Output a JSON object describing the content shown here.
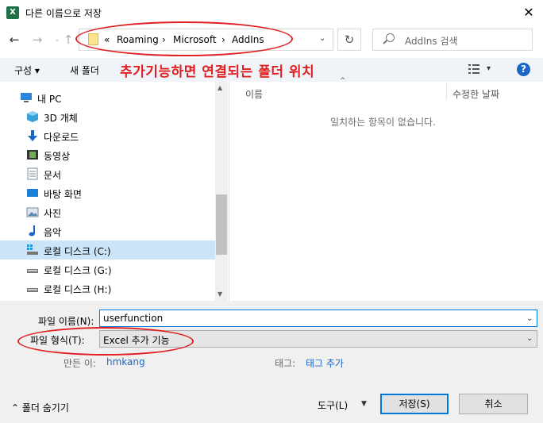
{
  "window": {
    "app_icon_text": "X",
    "title": "다른 이름으로 저장",
    "close_symbol": "✕"
  },
  "nav": {
    "back": "←",
    "forward": "→",
    "recent": "⌄",
    "up": "↑",
    "refresh": "↻",
    "address_dropdown": "⌄"
  },
  "address": {
    "crumbs": [
      "«",
      "Roaming",
      "›",
      "Microsoft",
      "›",
      "AddIns"
    ]
  },
  "search": {
    "placeholder": "AddIns 검색"
  },
  "toolbar": {
    "organize": "구성 ▾",
    "new_folder": "새 폴더",
    "view_dropdown": "▾",
    "help": "?"
  },
  "annotation": {
    "text": "추가기능하면 연결되는 폴더 위치",
    "color": "#e02020"
  },
  "tree": [
    {
      "label": "내 PC",
      "icon": "pc-icon"
    },
    {
      "label": "3D 개체",
      "icon": "3d-objects-icon"
    },
    {
      "label": "다운로드",
      "icon": "download-icon"
    },
    {
      "label": "동영상",
      "icon": "video-icon"
    },
    {
      "label": "문서",
      "icon": "document-icon"
    },
    {
      "label": "바탕 화면",
      "icon": "desktop-icon"
    },
    {
      "label": "사진",
      "icon": "pictures-icon"
    },
    {
      "label": "음악",
      "icon": "music-icon"
    },
    {
      "label": "로컬 디스크 (C:)",
      "icon": "local-disk-c-icon",
      "selected": true
    },
    {
      "label": "로컬 디스크 (G:)",
      "icon": "drive-icon"
    },
    {
      "label": "로컬 디스크 (H:)",
      "icon": "drive-icon"
    }
  ],
  "columns": {
    "name": "이름",
    "modified": "수정한 날짜",
    "sort_caret": "^"
  },
  "empty_message": "일치하는 항목이 없습니다.",
  "form": {
    "filename_label": "파일 이름(N):",
    "filename_value": "userfunction",
    "filetype_label": "파일 형식(T):",
    "filetype_value": "Excel 추가 기능",
    "dropdown": "⌄",
    "author_label": "만든 이:",
    "author_value": "hmkang",
    "tags_label": "태그:",
    "tags_value": "태그 추가"
  },
  "footer": {
    "hide_folders": "⌃  폴더 숨기기",
    "tools": "도구(L)",
    "tools_dropdown": "▼",
    "save": "저장(S)",
    "cancel": "취소"
  },
  "colors": {
    "accent": "#0078d7",
    "link": "#1a66c9",
    "selected": "#cce4f7",
    "excel_green": "#1e7145"
  }
}
